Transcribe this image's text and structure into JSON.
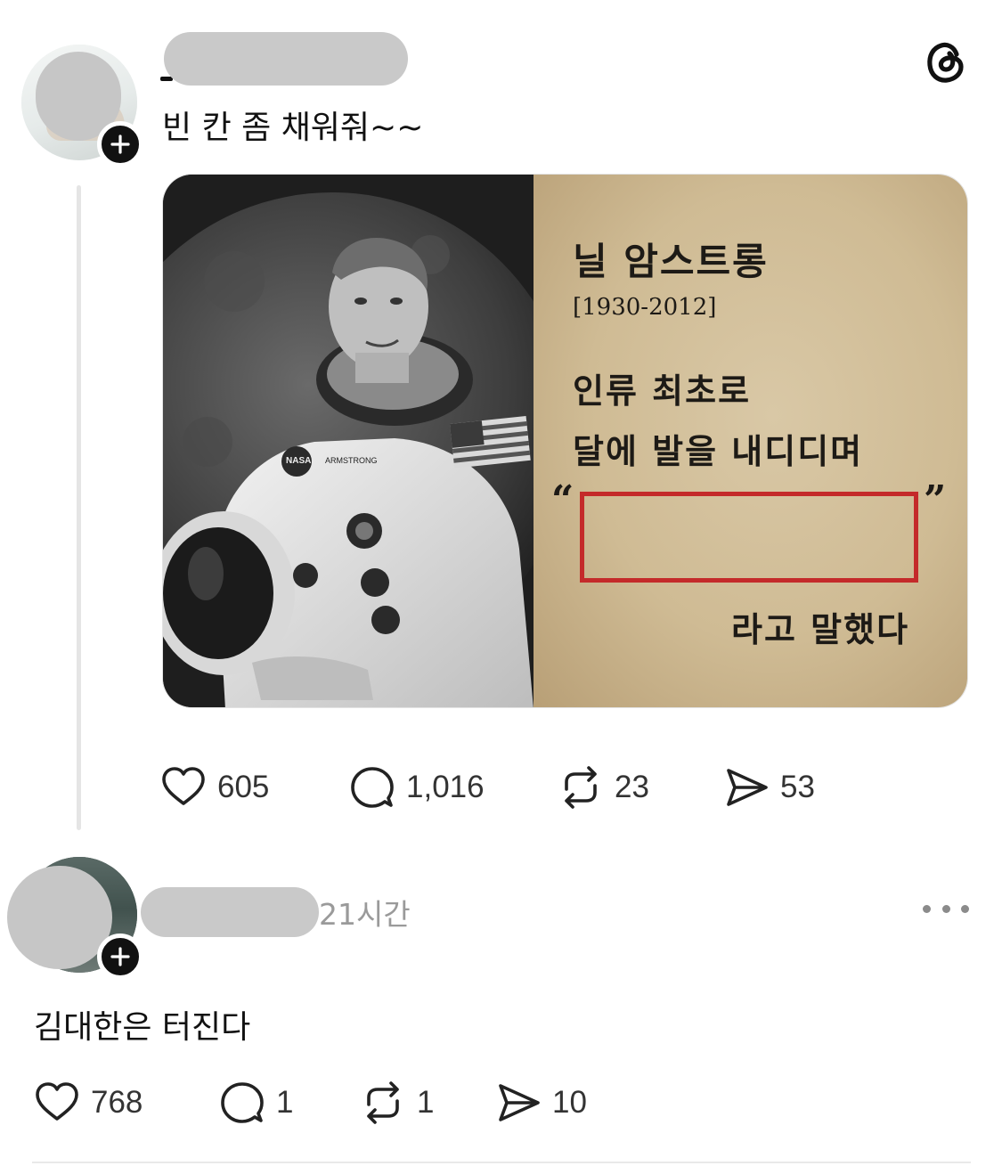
{
  "post": {
    "text": "빈 칸 좀 채워줘~~",
    "image": {
      "title": "닐 암스트롱",
      "years": "[1930-2012]",
      "line1": "인류 최초로",
      "line2": "달에 발을 내디디며",
      "quote_open": "“",
      "quote_close": "”",
      "line3": "라고 말했다",
      "suit_name": "ARMSTRONG",
      "suit_logo": "NASA",
      "blank_box_color": "#c42a2a"
    },
    "actions": {
      "likes": "605",
      "replies": "1,016",
      "reposts": "23",
      "shares": "53"
    }
  },
  "reply": {
    "time": "21시간",
    "text": "김대한은 터진다",
    "actions": {
      "likes": "768",
      "replies": "1",
      "reposts": "1",
      "shares": "10"
    }
  },
  "icons": {
    "app_logo": "threads-logo-icon",
    "follow": "plus-icon",
    "like": "heart-icon",
    "reply": "comment-icon",
    "repost": "repost-icon",
    "share": "send-icon",
    "more": "more-icon"
  }
}
